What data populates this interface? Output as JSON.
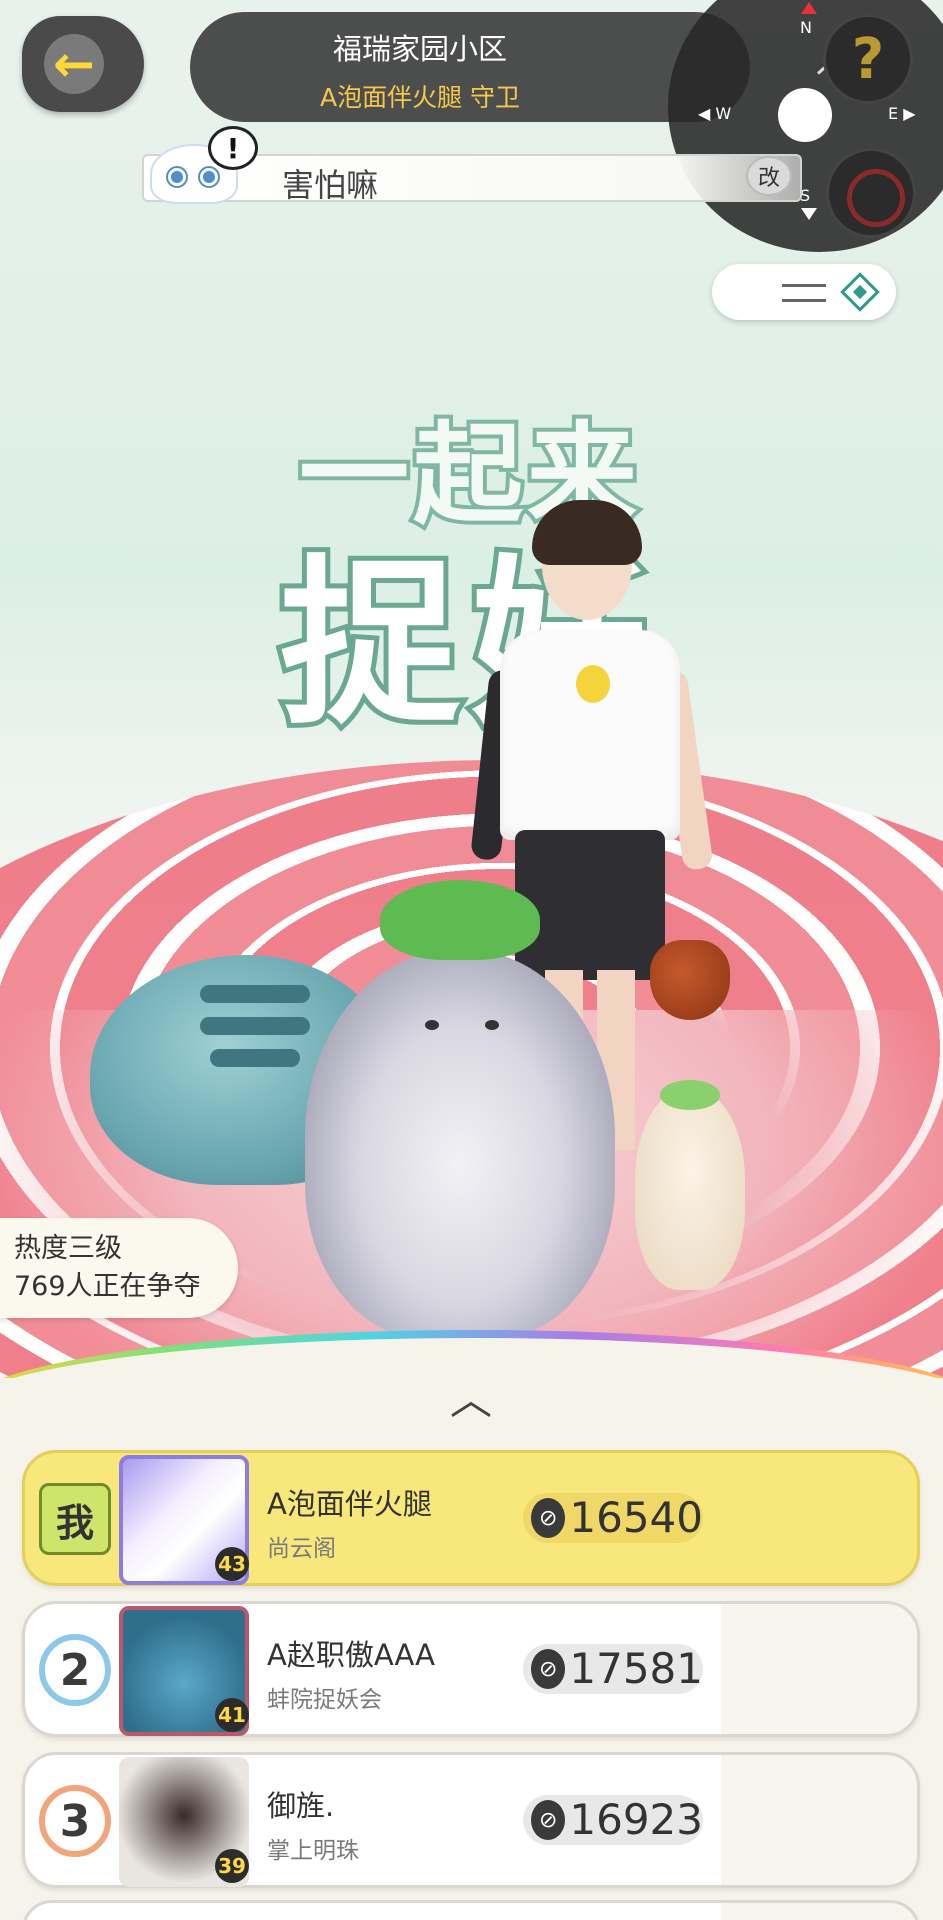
{
  "header": {
    "location": "福瑞家园小区",
    "guard_title": "A泡面伴火腿 守卫",
    "back_icon": "back-arrow-icon"
  },
  "compass": {
    "north": "N",
    "south": "S",
    "west": "◀ W",
    "east": "E ▶",
    "quest_glyph": "?"
  },
  "mood": {
    "alert_glyph": "!",
    "text": "害怕嘛",
    "edit_label": "改"
  },
  "heat": {
    "level": "热度三级",
    "contesting": "769人正在争夺"
  },
  "board": {
    "collapse_glyph": "︿",
    "rows": [
      {
        "rank_label": "我",
        "name": "A泡面伴火腿",
        "guild": "尚云阁",
        "level": "43",
        "score": "16540",
        "self": true
      },
      {
        "rank_label": "2",
        "name": "A赵职傲AAA",
        "guild": "蚌院捉妖会",
        "level": "41",
        "score": "17581",
        "self": false
      },
      {
        "rank_label": "3",
        "name": "御旌.",
        "guild": "掌上明珠",
        "level": "39",
        "score": "16923",
        "self": false
      }
    ]
  },
  "colors": {
    "accent_yellow": "#f8e77b",
    "guard_gold": "#f6c84a",
    "compass_north": "#e8323a"
  }
}
